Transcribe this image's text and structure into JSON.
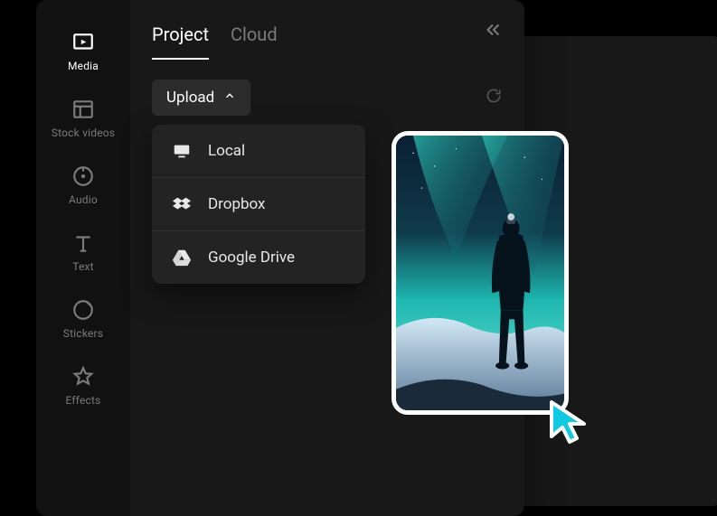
{
  "sidebar": {
    "items": [
      {
        "label": "Media"
      },
      {
        "label": "Stock videos"
      },
      {
        "label": "Audio"
      },
      {
        "label": "Text"
      },
      {
        "label": "Stickers"
      },
      {
        "label": "Effects"
      }
    ]
  },
  "tabs": {
    "project": "Project",
    "cloud": "Cloud"
  },
  "toolbar": {
    "upload_label": "Upload"
  },
  "upload_menu": {
    "items": [
      {
        "label": "Local"
      },
      {
        "label": "Dropbox"
      },
      {
        "label": "Google Drive"
      }
    ]
  }
}
